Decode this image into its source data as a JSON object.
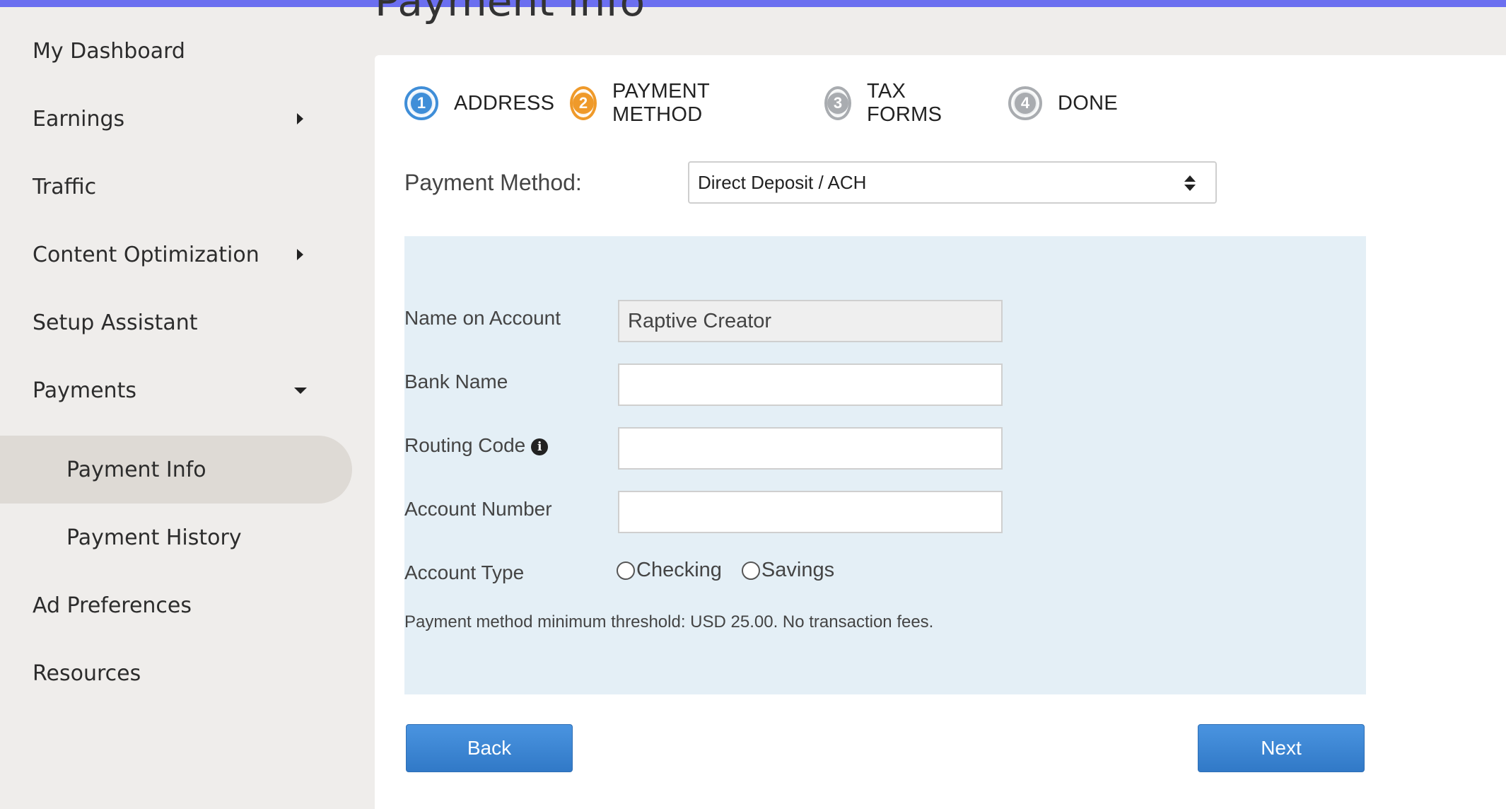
{
  "page": {
    "title": "Payment Info"
  },
  "sidebar": {
    "items": [
      {
        "label": "My Dashboard"
      },
      {
        "label": "Earnings"
      },
      {
        "label": "Traffic"
      },
      {
        "label": "Content Optimization"
      },
      {
        "label": "Setup Assistant"
      },
      {
        "label": "Payments"
      },
      {
        "label": "Payment Info"
      },
      {
        "label": "Payment History"
      },
      {
        "label": "Ad Preferences"
      },
      {
        "label": "Resources"
      }
    ],
    "active_item": "Payment Info"
  },
  "steps": [
    {
      "number": "1",
      "label": "ADDRESS",
      "state": "complete",
      "color": "#3f8ed8"
    },
    {
      "number": "2",
      "label": "PAYMENT METHOD",
      "state": "current",
      "color": "#ef9a2a"
    },
    {
      "number": "3",
      "label": "TAX FORMS",
      "state": "pending",
      "color": "#a9acb0"
    },
    {
      "number": "4",
      "label": "DONE",
      "state": "pending",
      "color": "#a9acb0"
    }
  ],
  "payment_method": {
    "label": "Payment Method:",
    "selected": "Direct Deposit / ACH"
  },
  "form": {
    "name_label": "Name on Account",
    "name_value": "Raptive Creator",
    "bank_label": "Bank Name",
    "bank_value": "",
    "routing_label": "Routing Code",
    "routing_value": "",
    "account_number_label": "Account Number",
    "account_number_value": "",
    "account_type_label": "Account Type",
    "account_type_options": [
      "Checking",
      "Savings"
    ],
    "threshold_note": "Payment method minimum threshold: USD 25.00. No transaction fees."
  },
  "buttons": {
    "back": "Back",
    "next": "Next"
  },
  "colors": {
    "accent_bar": "#6b6ff0",
    "button_blue": "#3b86d4",
    "form_panel_bg": "#e4eff6",
    "sidebar_active_bg": "#dedad5"
  }
}
